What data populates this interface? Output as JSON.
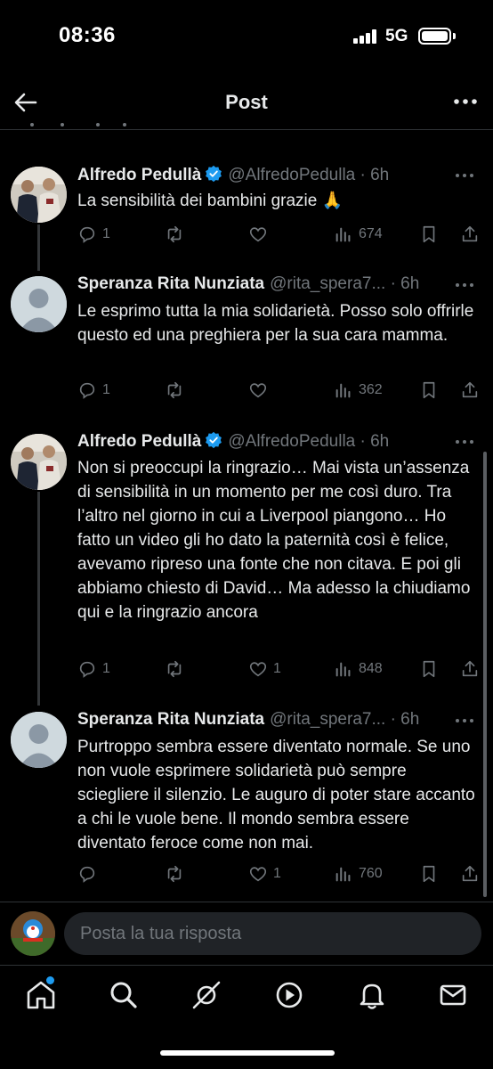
{
  "status_bar": {
    "time": "08:36",
    "network": "5G"
  },
  "header": {
    "title": "Post"
  },
  "posts": [
    {
      "author": "Alfredo Pedullà",
      "handle": "@AlfredoPedulla · 6h",
      "verified": true,
      "text": "La sensibilità dei bambini grazie 🙏",
      "replies": "1",
      "reposts": "",
      "likes": "",
      "views": "674"
    },
    {
      "author": "Speranza Rita Nunziata",
      "handle": "@rita_spera7... · 6h",
      "verified": false,
      "text": "Le esprimo tutta la mia solidarietà. Posso solo offrirle questo ed una preghiera per la sua cara mamma.",
      "replies": "1",
      "reposts": "",
      "likes": "",
      "views": "362"
    },
    {
      "author": "Alfredo Pedullà",
      "handle": "@AlfredoPedulla · 6h",
      "verified": true,
      "text": "Non si preoccupi la ringrazio… Mai vista un’assenza di sensibilità in un momento per me così duro. Tra l’altro nel giorno in cui a Liverpool piangono… Ho fatto un video gli ho dato la paternità così è felice, avevamo ripreso una fonte che non citava. E poi gli abbiamo chiesto di David… Ma adesso la chiudiamo qui e la ringrazio ancora",
      "replies": "1",
      "reposts": "",
      "likes": "1",
      "views": "848"
    },
    {
      "author": "Speranza Rita Nunziata",
      "handle": "@rita_spera7... · 6h",
      "verified": false,
      "text": "Purtroppo sembra essere diventato normale. Se uno non vuole esprimere solidarietà può sempre sciegliere il silenzio. Le auguro di poter stare accanto a chi le vuole bene. Il mondo sembra essere diventato feroce come non mai.",
      "replies": "",
      "reposts": "",
      "likes": "1",
      "views": "760"
    }
  ],
  "reply": {
    "placeholder": "Posta la tua risposta"
  },
  "nav": {
    "items": [
      "home-icon",
      "search-icon",
      "grok-icon",
      "video-icon",
      "notifications-icon",
      "messages-icon"
    ],
    "active": "home-icon"
  },
  "colors": {
    "background": "#000000",
    "text": "#e7e9ea",
    "muted": "#71767b",
    "accent": "#1d9bf0",
    "divider": "#2f3336"
  }
}
